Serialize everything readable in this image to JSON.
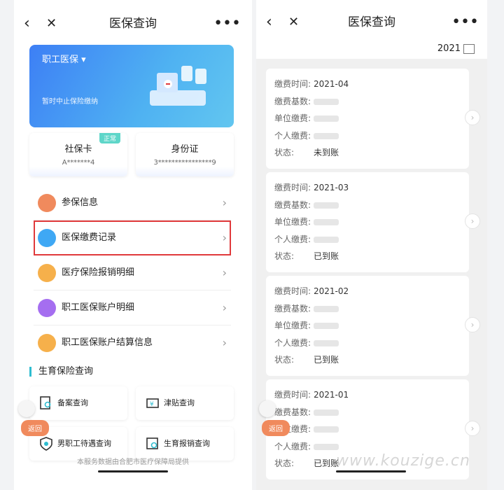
{
  "left": {
    "title": "医保查询",
    "insurance_type": "职工医保",
    "banner_hint": "暂时中止保险缴纳",
    "cards": [
      {
        "title": "社保卡",
        "number": "A*******4",
        "badge": "正常"
      },
      {
        "title": "身份证",
        "number": "3****************9"
      }
    ],
    "menu": [
      {
        "label": "参保信息",
        "icon_color": "#f08a5d"
      },
      {
        "label": "医保缴费记录",
        "icon_color": "#3fa8f4"
      },
      {
        "label": "医疗保险报销明细",
        "icon_color": "#f6b04b"
      },
      {
        "label": "职工医保账户明细",
        "icon_color": "#a56ef0"
      },
      {
        "label": "职工医保账户结算信息",
        "icon_color": "#f6b04b"
      }
    ],
    "section_title": "生育保险查询",
    "grid": [
      {
        "label": "备案查询"
      },
      {
        "label": "津贴查询"
      },
      {
        "label": "男职工待遇查询"
      },
      {
        "label": "生育报销查询"
      }
    ],
    "float_label": "返回",
    "footer": "本服务数据由合肥市医疗保障局提供"
  },
  "right": {
    "title": "医保查询",
    "year": "2021",
    "labels": {
      "time": "缴费时间:",
      "base": "缴费基数:",
      "unit": "单位缴费:",
      "personal": "个人缴费:",
      "status": "状态:"
    },
    "records": [
      {
        "time": "2021-04",
        "status": "未到账"
      },
      {
        "time": "2021-03",
        "status": "已到账"
      },
      {
        "time": "2021-02",
        "status": "已到账"
      },
      {
        "time": "2021-01",
        "status": "已到账"
      }
    ],
    "float_label": "返回"
  },
  "watermark": "www.kouzige.cn",
  "colors": {
    "accent": "#3d7ff5",
    "highlight": "#e0393b",
    "section_bar": "#2fbdd0"
  }
}
